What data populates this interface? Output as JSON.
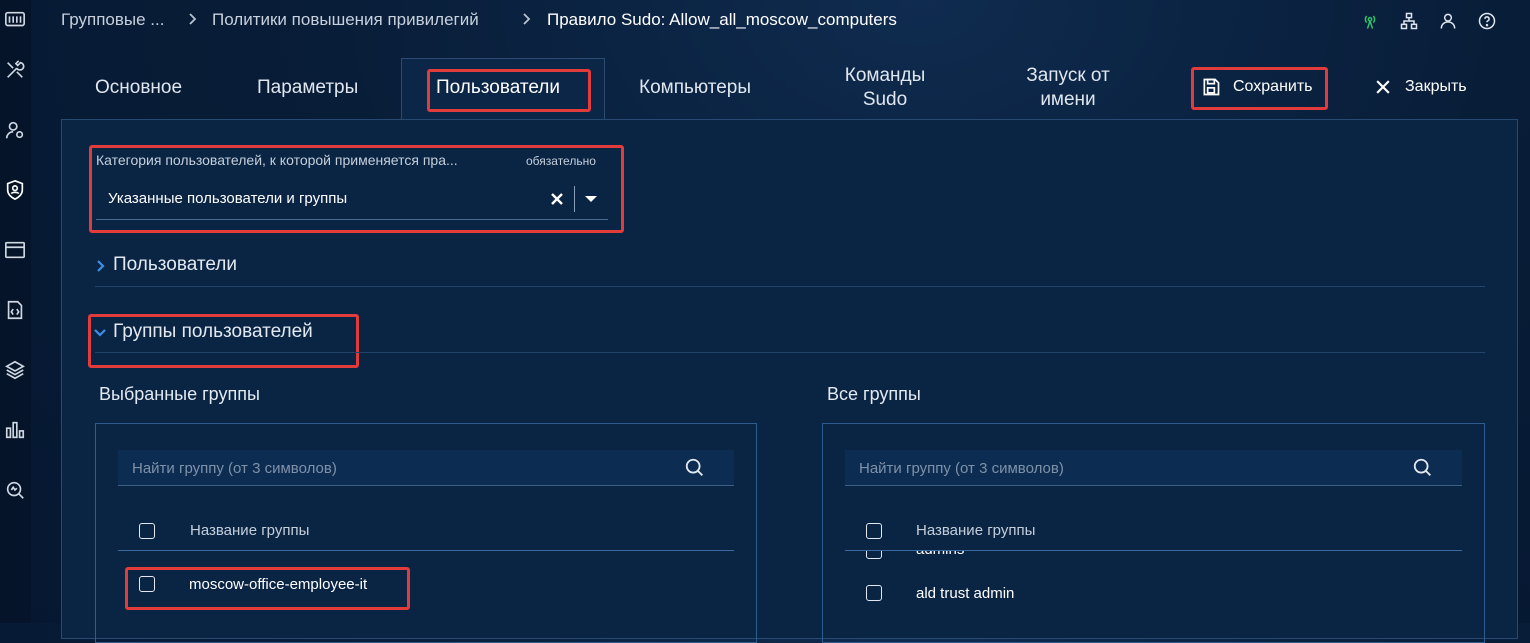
{
  "breadcrumb": {
    "items": [
      "Групповые ...",
      "Политики повышения привилегий"
    ],
    "current": "Правило Sudo: Allow_all_moscow_computers"
  },
  "tabs": [
    {
      "label": "Основное"
    },
    {
      "label": "Параметры"
    },
    {
      "label": "Пользователи"
    },
    {
      "label": "Компьютеры"
    },
    {
      "label": "Команды Sudo"
    },
    {
      "label": "Запуск от имени"
    }
  ],
  "actions": {
    "save_label": "Сохранить",
    "close_label": "Закрыть"
  },
  "category_field": {
    "label": "Категория пользователей, к которой применяется пра...",
    "required": "обязательно",
    "value": "Указанные пользователи и группы"
  },
  "sections": {
    "users": "Пользователи",
    "groups": "Группы пользователей"
  },
  "selected_groups": {
    "title": "Выбранные группы",
    "search_placeholder": "Найти группу (от 3 символов)",
    "column": "Название группы",
    "rows": [
      "moscow-office-employee-it"
    ]
  },
  "all_groups": {
    "title": "Все группы",
    "search_placeholder": "Найти группу (от 3 символов)",
    "column": "Название группы",
    "rows": [
      "admins",
      "ald trust admin"
    ]
  },
  "colors": {
    "background": "#071a33",
    "panel": "#0a2444",
    "accent": "#3e8ee8",
    "highlight": "#e23b3b",
    "status_green": "#2fc36b"
  }
}
